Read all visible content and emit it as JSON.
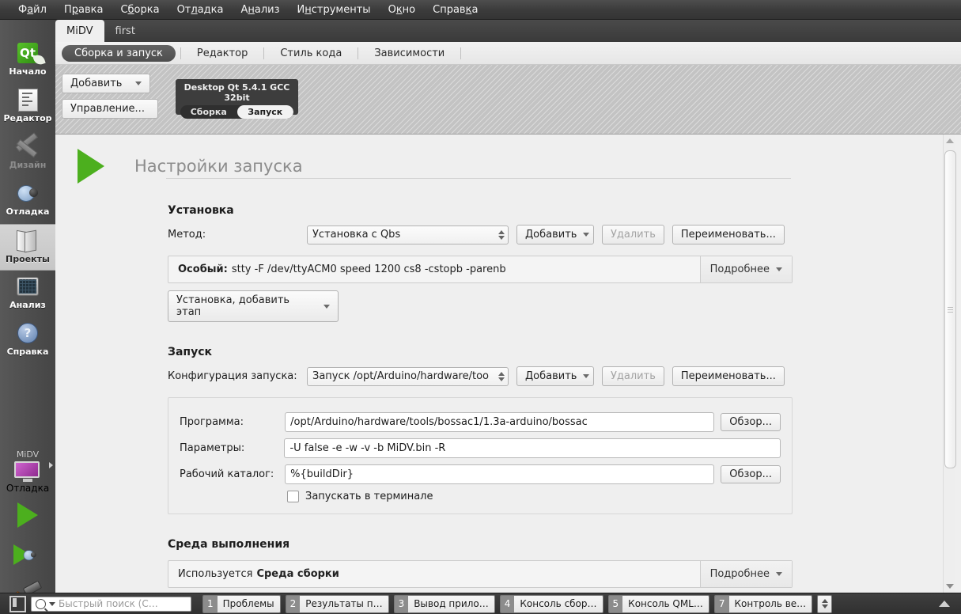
{
  "menubar": {
    "items": [
      {
        "label": "Файл"
      },
      {
        "label": "Правка"
      },
      {
        "label": "Сборка"
      },
      {
        "label": "Отладка"
      },
      {
        "label": "Анализ"
      },
      {
        "label": "Инструменты"
      },
      {
        "label": "Окно"
      },
      {
        "label": "Справка"
      }
    ]
  },
  "modebar": {
    "items": [
      {
        "label": "Начало",
        "icon": "qt-logo-icon"
      },
      {
        "label": "Редактор",
        "icon": "document-icon"
      },
      {
        "label": "Дизайн",
        "icon": "design-ruler-pencil-icon"
      },
      {
        "label": "Отладка",
        "icon": "bug-icon"
      },
      {
        "label": "Проекты",
        "icon": "projects-folder-icon"
      },
      {
        "label": "Анализ",
        "icon": "analyzer-screen-icon"
      },
      {
        "label": "Справка",
        "icon": "help-question-icon"
      }
    ],
    "kit": {
      "project_name": "MiDV",
      "run_mode": "Отладка"
    }
  },
  "project_tabs": [
    {
      "label": "MiDV"
    },
    {
      "label": "first"
    }
  ],
  "sub_tabs": [
    {
      "label": "Сборка и запуск"
    },
    {
      "label": "Редактор"
    },
    {
      "label": "Стиль кода"
    },
    {
      "label": "Зависимости"
    }
  ],
  "kitbar": {
    "add_button": "Добавить",
    "manage_button": "Управление...",
    "kit_title": "Desktop Qt 5.4.1 GCC 32bit",
    "kit_build": "Сборка",
    "kit_run": "Запуск"
  },
  "page": {
    "title": "Настройки запуска"
  },
  "deploy": {
    "section_title": "Установка",
    "method_label": "Метод:",
    "method_value": "Установка с Qbs",
    "add_button": "Добавить",
    "remove_button": "Удалить",
    "rename_button": "Переименовать...",
    "step_label": "Особый:",
    "step_command": "stty -F /dev/ttyACM0 speed 1200 cs8 -cstopb -parenb",
    "details_button": "Подробнее",
    "add_step_button": "Установка, добавить этап"
  },
  "run": {
    "section_title": "Запуск",
    "config_label": "Конфигурация запуска:",
    "config_value": "Запуск /opt/Arduino/hardware/too",
    "add_button": "Добавить",
    "remove_button": "Удалить",
    "rename_button": "Переименовать...",
    "program_label": "Программа:",
    "program_value": "/opt/Arduino/hardware/tools/bossac1/1.3a-arduino/bossac",
    "arguments_label": "Параметры:",
    "arguments_value": "-U false -e -w -v -b MiDV.bin -R",
    "workdir_label": "Рабочий каталог:",
    "workdir_value": "%{buildDir}",
    "browse_button": "Обзор...",
    "terminal_checkbox": "Запускать в терминале",
    "terminal_checked": false
  },
  "environment": {
    "section_title": "Среда выполнения",
    "summary_prefix": "Используется",
    "summary_strong": "Среда сборки",
    "details_button": "Подробнее"
  },
  "statusbar": {
    "search_placeholder": "Быстрый поиск (С…",
    "panes": [
      {
        "number": "1",
        "label": "Проблемы"
      },
      {
        "number": "2",
        "label": "Результаты п…"
      },
      {
        "number": "3",
        "label": "Вывод прило…"
      },
      {
        "number": "4",
        "label": "Консоль сбор…"
      },
      {
        "number": "5",
        "label": "Консоль QML…"
      },
      {
        "number": "7",
        "label": "Контроль ве…"
      }
    ]
  },
  "colors": {
    "accent_green": "#4caf1e",
    "kit_purple": "#a33ba3",
    "chrome_dark": "#3c3c3c",
    "panel_bg": "#efefef"
  }
}
